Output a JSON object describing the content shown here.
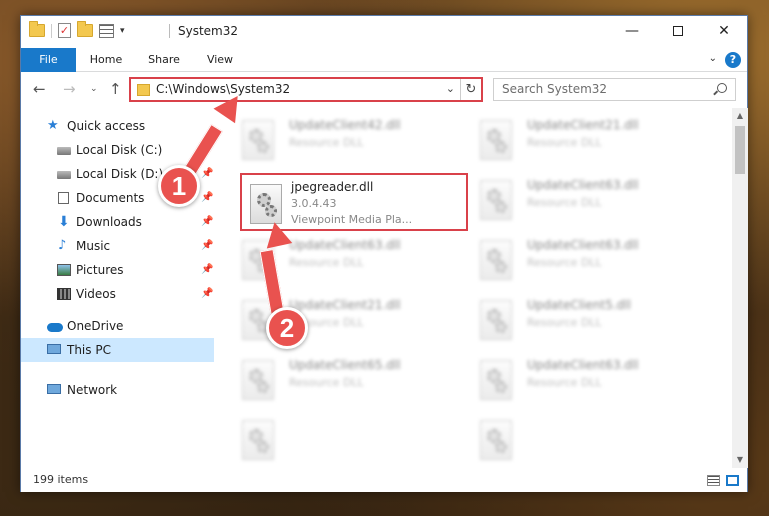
{
  "window": {
    "title": "System32"
  },
  "ribbon": {
    "tabs": [
      {
        "label": "File"
      },
      {
        "label": "Home"
      },
      {
        "label": "Share"
      },
      {
        "label": "View"
      }
    ]
  },
  "address": {
    "path": "C:\\Windows\\System32"
  },
  "search": {
    "placeholder": "Search System32"
  },
  "navpane": {
    "items": [
      {
        "label": "Quick access",
        "icon": "star-icon"
      },
      {
        "label": "Local Disk (C:)",
        "icon": "disk-icon"
      },
      {
        "label": "Local Disk (D:)",
        "icon": "disk-icon"
      },
      {
        "label": "Documents",
        "icon": "documents-icon"
      },
      {
        "label": "Downloads",
        "icon": "downloads-icon"
      },
      {
        "label": "Music",
        "icon": "music-icon"
      },
      {
        "label": "Pictures",
        "icon": "pictures-icon"
      },
      {
        "label": "Videos",
        "icon": "videos-icon"
      },
      {
        "label": "OneDrive",
        "icon": "onedrive-icon"
      },
      {
        "label": "This PC",
        "icon": "this-pc-icon",
        "selected": true
      },
      {
        "label": "Network",
        "icon": "network-icon"
      }
    ]
  },
  "files": {
    "highlighted": {
      "name": "jpegreader.dll",
      "version": "3.0.4.43",
      "description": "Viewpoint Media Pla..."
    },
    "tiles": [
      {
        "name": "UpdateClient42.dll",
        "type": "Resource DLL"
      },
      {
        "name": "UpdateClient21.dll",
        "type": "Resource DLL"
      },
      {
        "name": "UpdateClient63.dll",
        "type": "Resource DLL"
      },
      {
        "name": "UpdateClient63.dll",
        "type": "Resource DLL"
      },
      {
        "name": "UpdateClient63.dll",
        "type": "Resource DLL"
      },
      {
        "name": "UpdateClient21.dll",
        "type": "Resource DLL"
      },
      {
        "name": "UpdateClient5.dll",
        "type": "Resource DLL"
      },
      {
        "name": "UpdateClient65.dll",
        "type": "Resource DLL"
      },
      {
        "name": "UpdateClient63.dll",
        "type": "Resource DLL"
      },
      {
        "name": "",
        "type": ""
      },
      {
        "name": "",
        "type": ""
      }
    ]
  },
  "status": {
    "item_count": "199 items"
  },
  "annotations": {
    "step1": "1",
    "step2": "2"
  },
  "colors": {
    "accent": "#1979ca",
    "highlight_border": "#d9414a",
    "annotation": "#e9524f",
    "selected_bg": "#cce8ff"
  }
}
